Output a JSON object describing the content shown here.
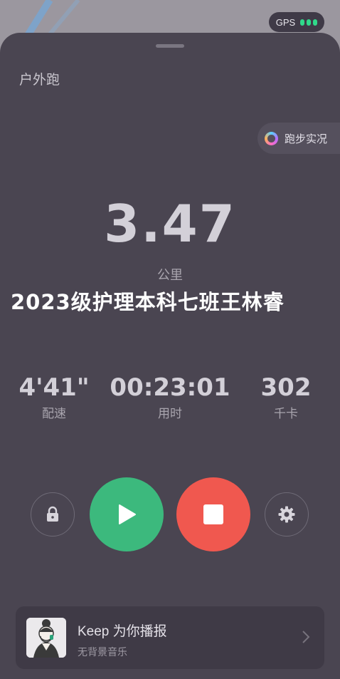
{
  "status": {
    "gps_label": "GPS",
    "signal_bars": 3,
    "signal_color": "#30d98a"
  },
  "header": {
    "title": "户外跑",
    "live_button": "跑步实况"
  },
  "main": {
    "distance": "3.47",
    "distance_unit": "公里",
    "overlay_text": "2023级护理本科七班王林睿"
  },
  "stats": [
    {
      "value": "4'41\"",
      "label": "配速"
    },
    {
      "value": "00:23:01",
      "label": "用时"
    },
    {
      "value": "302",
      "label": "千卡"
    }
  ],
  "controls": {
    "lock_icon": "lock-icon",
    "play_icon": "play-icon",
    "stop_icon": "stop-icon",
    "settings_icon": "gear-icon",
    "play_color": "#3cb97d",
    "stop_color": "#f0584f"
  },
  "keep_card": {
    "name": "Keep 为你播报",
    "subtitle": "无背景音乐"
  }
}
